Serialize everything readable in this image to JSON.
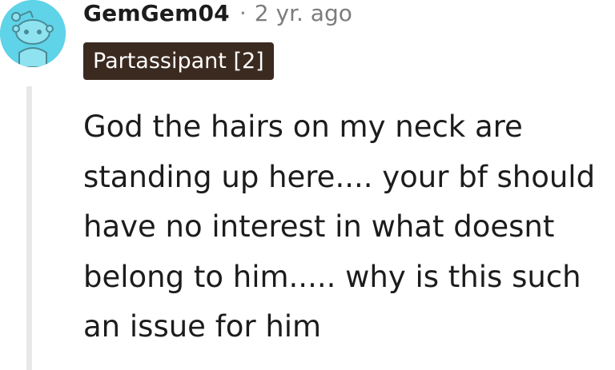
{
  "comment": {
    "avatar_icon": "snoo-avatar-icon",
    "avatar_color": "#5fd3e8",
    "username": "GemGem04",
    "separator": "·",
    "timestamp": "2 yr. ago",
    "flair": "Partassipant [2]",
    "flair_color": "#3b2a20",
    "body": "God the hairs on my neck are standing up here.... your bf should have no interest in what doesnt belong to him..... why is this such an issue for him"
  }
}
